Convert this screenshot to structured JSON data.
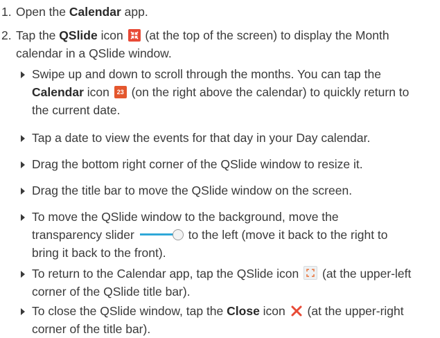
{
  "steps": [
    {
      "number": "1.",
      "pre": "Open the ",
      "bold": "Calendar",
      "post": " app."
    },
    {
      "number": "2.",
      "pre": "Tap the ",
      "bold": "QSlide",
      "mid": " icon",
      "icon": "qslide-icon",
      "post_line1": " (at the top of the screen) to display the Month",
      "post_line2": "calendar in a QSlide window."
    }
  ],
  "bullets": [
    {
      "line1": "Swipe up and down to scroll through the months. You can tap the",
      "bold": "Calendar",
      "mid": " icon",
      "icon": "calendar-icon",
      "icon_text": "23",
      "post_line2": " (on the right above the calendar) to quickly return to",
      "line3": "the current date."
    },
    {
      "line1": "Tap a date to view the events for that day in your Day calendar."
    },
    {
      "line1": "Drag the bottom right corner of the QSlide window to resize it."
    },
    {
      "line1": "Drag the title bar to move the QSlide window on the screen."
    },
    {
      "line1": "To move the QSlide window to the background, move the",
      "pre_line2": "transparency slider",
      "icon": "transparency-slider-icon",
      "post_line2": " to the left (move it back to the right to",
      "line3": "bring it back to the front)."
    },
    {
      "pre_line1": "To return to the Calendar app, tap the QSlide icon",
      "icon": "qslide-titlebar-icon",
      "post_line1": " (at the upper-left",
      "line2": "corner of the QSlide title bar)."
    },
    {
      "pre_line1": "To close the QSlide window, tap the ",
      "bold": "Close",
      "mid": " icon",
      "icon": "close-icon",
      "post_line1": " (at the upper-right",
      "line2": "corner of the title bar)."
    }
  ],
  "colors": {
    "text": "#3a3a3a",
    "qslide_icon": "#e84a36",
    "calendar_icon": "#e4572e",
    "slider_track": "#2fa8d8",
    "close_icon": "#e84a36"
  }
}
